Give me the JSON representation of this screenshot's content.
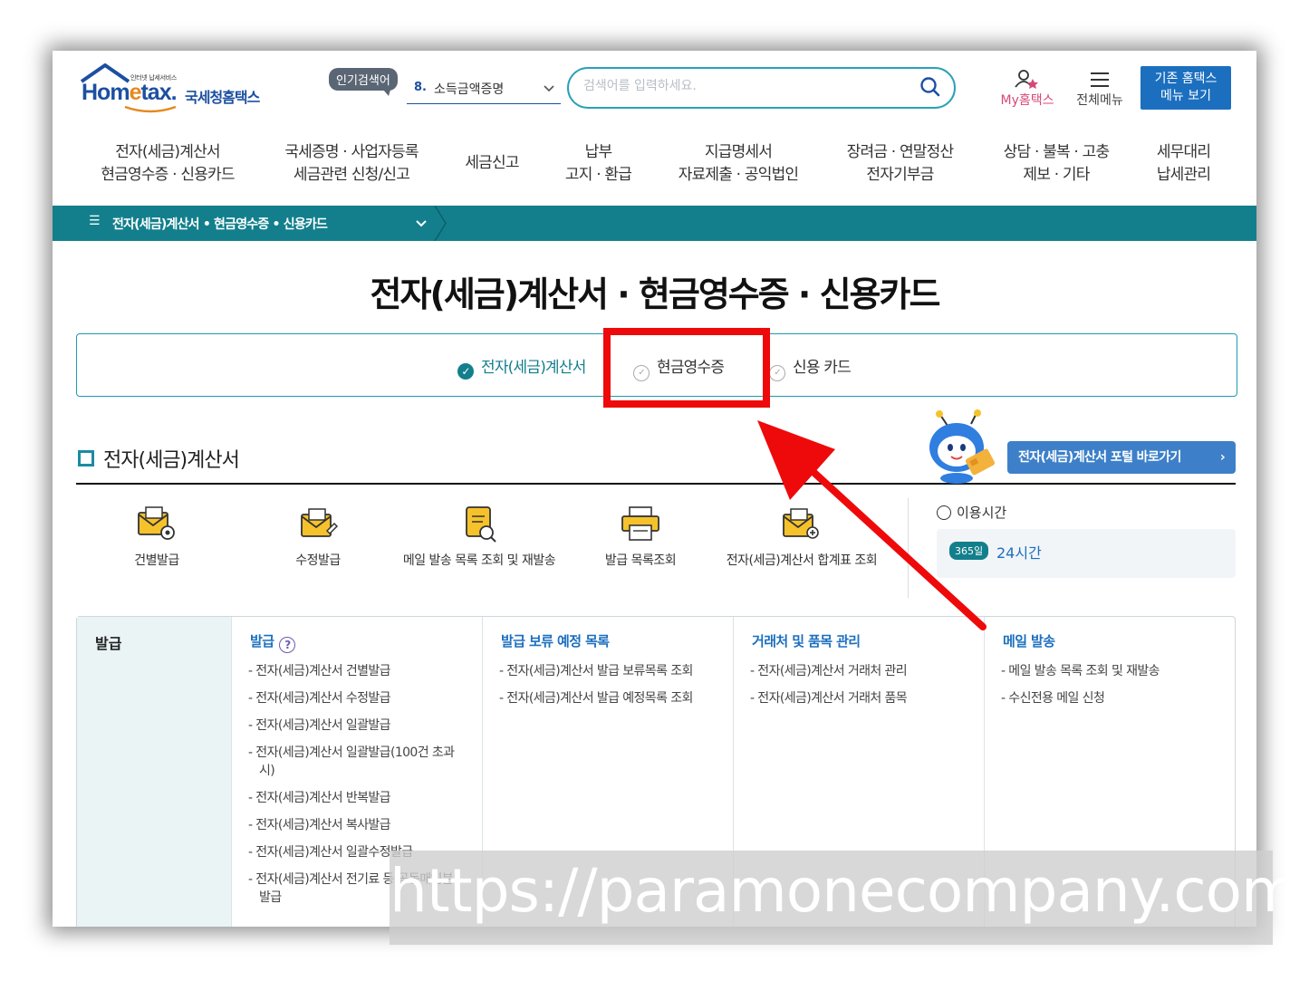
{
  "header": {
    "logo_small": "인터넷 납세서비스",
    "logo_main_a": "Hom",
    "logo_main_e": "e",
    "logo_main_b": "tax.",
    "logo_kr": "국세청홈택스",
    "popular_badge": "인기검색어",
    "popular_num": "8.",
    "popular_term": "소득금액증명",
    "search_placeholder": "검색어를 입력하세요.",
    "my_label": "My홈택스",
    "allmenu_label": "전체메뉴",
    "old_menu_line1": "기존 홈택스",
    "old_menu_line2": "메뉴 보기"
  },
  "gnb": [
    {
      "line1": "전자(세금)계산서",
      "line2": "현금영수증 · 신용카드"
    },
    {
      "line1": "국세증명 · 사업자등록",
      "line2": "세금관련 신청/신고"
    },
    {
      "line1": "세금신고",
      "line2": ""
    },
    {
      "line1": "납부",
      "line2": "고지 · 환급"
    },
    {
      "line1": "지급명세서",
      "line2": "자료제출 · 공익법인"
    },
    {
      "line1": "장려금 · 연말정산",
      "line2": "전자기부금"
    },
    {
      "line1": "상담 · 불복 · 고충",
      "line2": "제보 · 기타"
    },
    {
      "line1": "세무대리",
      "line2": "납세관리"
    }
  ],
  "breadcrumb": {
    "text": "전자(세금)계산서 • 현금영수증 • 신용카드"
  },
  "page_title": "전자(세금)계산서 · 현금영수증 · 신용카드",
  "tabs": [
    {
      "label": "전자(세금)계산서",
      "active": true
    },
    {
      "label": "현금영수증",
      "active": false
    },
    {
      "label": "신용 카드",
      "active": false
    }
  ],
  "section": {
    "title": "전자(세금)계산서",
    "portal_button": "전자(세금)계산서 포털 바로가기",
    "quick_icons": [
      {
        "label": "건별발급",
        "icon": "envelope-gear-icon"
      },
      {
        "label": "수정발급",
        "icon": "envelope-edit-icon"
      },
      {
        "label": "메일 발송 목록 조회 및 재발송",
        "icon": "scroll-search-icon"
      },
      {
        "label": "발급 목록조회",
        "icon": "printer-icon"
      },
      {
        "label": "전자(세금)계산서 합계표 조회",
        "icon": "envelope-plus-icon"
      }
    ],
    "usage_time_title": "이용시간",
    "usage_badge": "365일",
    "usage_value": "24시간"
  },
  "grid": {
    "head": "발급",
    "columns": [
      {
        "title": "발급",
        "help": "?",
        "items": [
          "- 전자(세금)계산서 건별발급",
          "- 전자(세금)계산서 수정발급",
          "- 전자(세금)계산서 일괄발급",
          "- 전자(세금)계산서 일괄발급(100건 초과 시)",
          "- 전자(세금)계산서 반복발급",
          "- 전자(세금)계산서 복사발급",
          "- 전자(세금)계산서 일괄수정발급",
          "- 전자(세금)계산서 전기료 등 공동매입분 발급"
        ]
      },
      {
        "title": "발급 보류 예정 목록",
        "items": [
          "- 전자(세금)계산서 발급 보류목록 조회",
          "- 전자(세금)계산서 발급 예정목록 조회"
        ]
      },
      {
        "title": "거래처 및 품목 관리",
        "items": [
          "- 전자(세금)계산서 거래처 관리",
          "- 전자(세금)계산서 거래처 품목"
        ]
      },
      {
        "title": "메일 발송",
        "items": [
          "- 메일 발송 목록 조회 및 재발송",
          "- 수신전용 메일 신청"
        ]
      }
    ]
  },
  "watermark": "https://paramonecompany.com",
  "colors": {
    "teal": "#137f8c",
    "blue": "#1c6fbf",
    "highlight_red": "#ee0a0a"
  }
}
